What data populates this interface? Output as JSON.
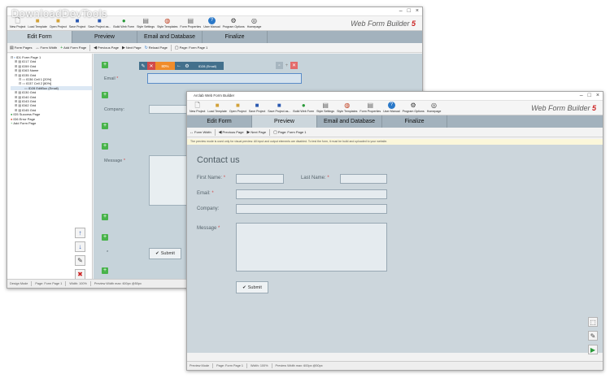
{
  "brand": {
    "name": "Web Form Builder",
    "version": "5"
  },
  "toolbar_items": [
    {
      "icon": "new-project-icon",
      "glyph": "🗋",
      "label": "New Project"
    },
    {
      "icon": "load-template-icon",
      "glyph": "📂",
      "label": "Load Template"
    },
    {
      "icon": "open-project-icon",
      "glyph": "📁",
      "label": "Open Project"
    },
    {
      "icon": "save-project-icon",
      "glyph": "💾",
      "label": "Save Project"
    },
    {
      "icon": "save-project-as-icon",
      "glyph": "💾",
      "label": "Save Project as..."
    },
    {
      "icon": "build-web-form-icon",
      "glyph": "▶",
      "label": "Build Web Form"
    },
    {
      "icon": "style-settings-icon",
      "glyph": "📄",
      "label": "Style Settings"
    },
    {
      "icon": "style-templates-icon",
      "glyph": "◍",
      "label": "Style Templates"
    },
    {
      "icon": "form-properties-icon",
      "glyph": "📄",
      "label": "Form Properties"
    },
    {
      "icon": "user-manual-icon",
      "glyph": "?",
      "label": "User Manual"
    },
    {
      "icon": "program-options-icon",
      "glyph": "⚙",
      "label": "Program Options"
    },
    {
      "icon": "homepage-icon",
      "glyph": "🌐",
      "label": "Homepage"
    }
  ],
  "tabs": [
    "Edit Form",
    "Preview",
    "Email and Database",
    "Finalize"
  ],
  "editor_window": {
    "subtoolbar": [
      "Form Pages",
      "Form Width",
      "Add Form Page",
      "Previous Page",
      "Next Page",
      "Reload Page",
      "Page: Form Page 1"
    ],
    "tree": [
      {
        "indent": 0,
        "text": "ID1 Form Page 1"
      },
      {
        "indent": 1,
        "text": "ID17 Grid"
      },
      {
        "indent": 1,
        "text": "ID59 Grid"
      },
      {
        "indent": 1,
        "text": "ID63 Name"
      },
      {
        "indent": 1,
        "text": "ID35 Grid"
      },
      {
        "indent": 2,
        "text": "ID36 Cell 1 [20%]"
      },
      {
        "indent": 2,
        "text": "ID37 Cell 2 [80%]"
      },
      {
        "indent": 3,
        "text": "ID28 EditBox (Email)"
      },
      {
        "indent": 1,
        "text": "ID30 Grid"
      },
      {
        "indent": 1,
        "text": "ID40 Grid"
      },
      {
        "indent": 1,
        "text": "ID43 Grid"
      },
      {
        "indent": 1,
        "text": "ID62 Grid"
      },
      {
        "indent": 1,
        "text": "ID45 Grid"
      },
      {
        "indent": 0,
        "text": "ID5 Success Page"
      },
      {
        "indent": 0,
        "text": "ID6 Error Page"
      },
      {
        "indent": 0,
        "text": "Add Form Page"
      }
    ],
    "field_toolbar": {
      "zoom": "80%",
      "field_id": "ID28 (Email)"
    },
    "labels": {
      "email": "Email",
      "company": "Company:",
      "message": "Message",
      "submit": "Submit"
    },
    "status": [
      "Design Mode",
      "Page: Form Page 1",
      "Width: 100%",
      "Preview Width max: 600px @50px"
    ]
  },
  "preview_window": {
    "title": "Arclab Web Form Builder",
    "subtoolbar": [
      "Form Width",
      "Previous Page",
      "Next Page",
      "Page: Form Page 1"
    ],
    "notice": "The preview mode is used only for visual preview. All input and output elements are disabled. To test the form, it must be build and uploaded to your website.",
    "form_title": "Contact us",
    "labels": {
      "first_name": "First Name:",
      "last_name": "Last Name:",
      "email": "Email:",
      "company": "Company:",
      "message": "Message",
      "submit": "Submit"
    },
    "status": [
      "Preview Mode",
      "Page: Form Page 1",
      "Width: 100%",
      "Preview Width max: 600px @50px"
    ]
  },
  "watermark": "DownloadDevTools"
}
